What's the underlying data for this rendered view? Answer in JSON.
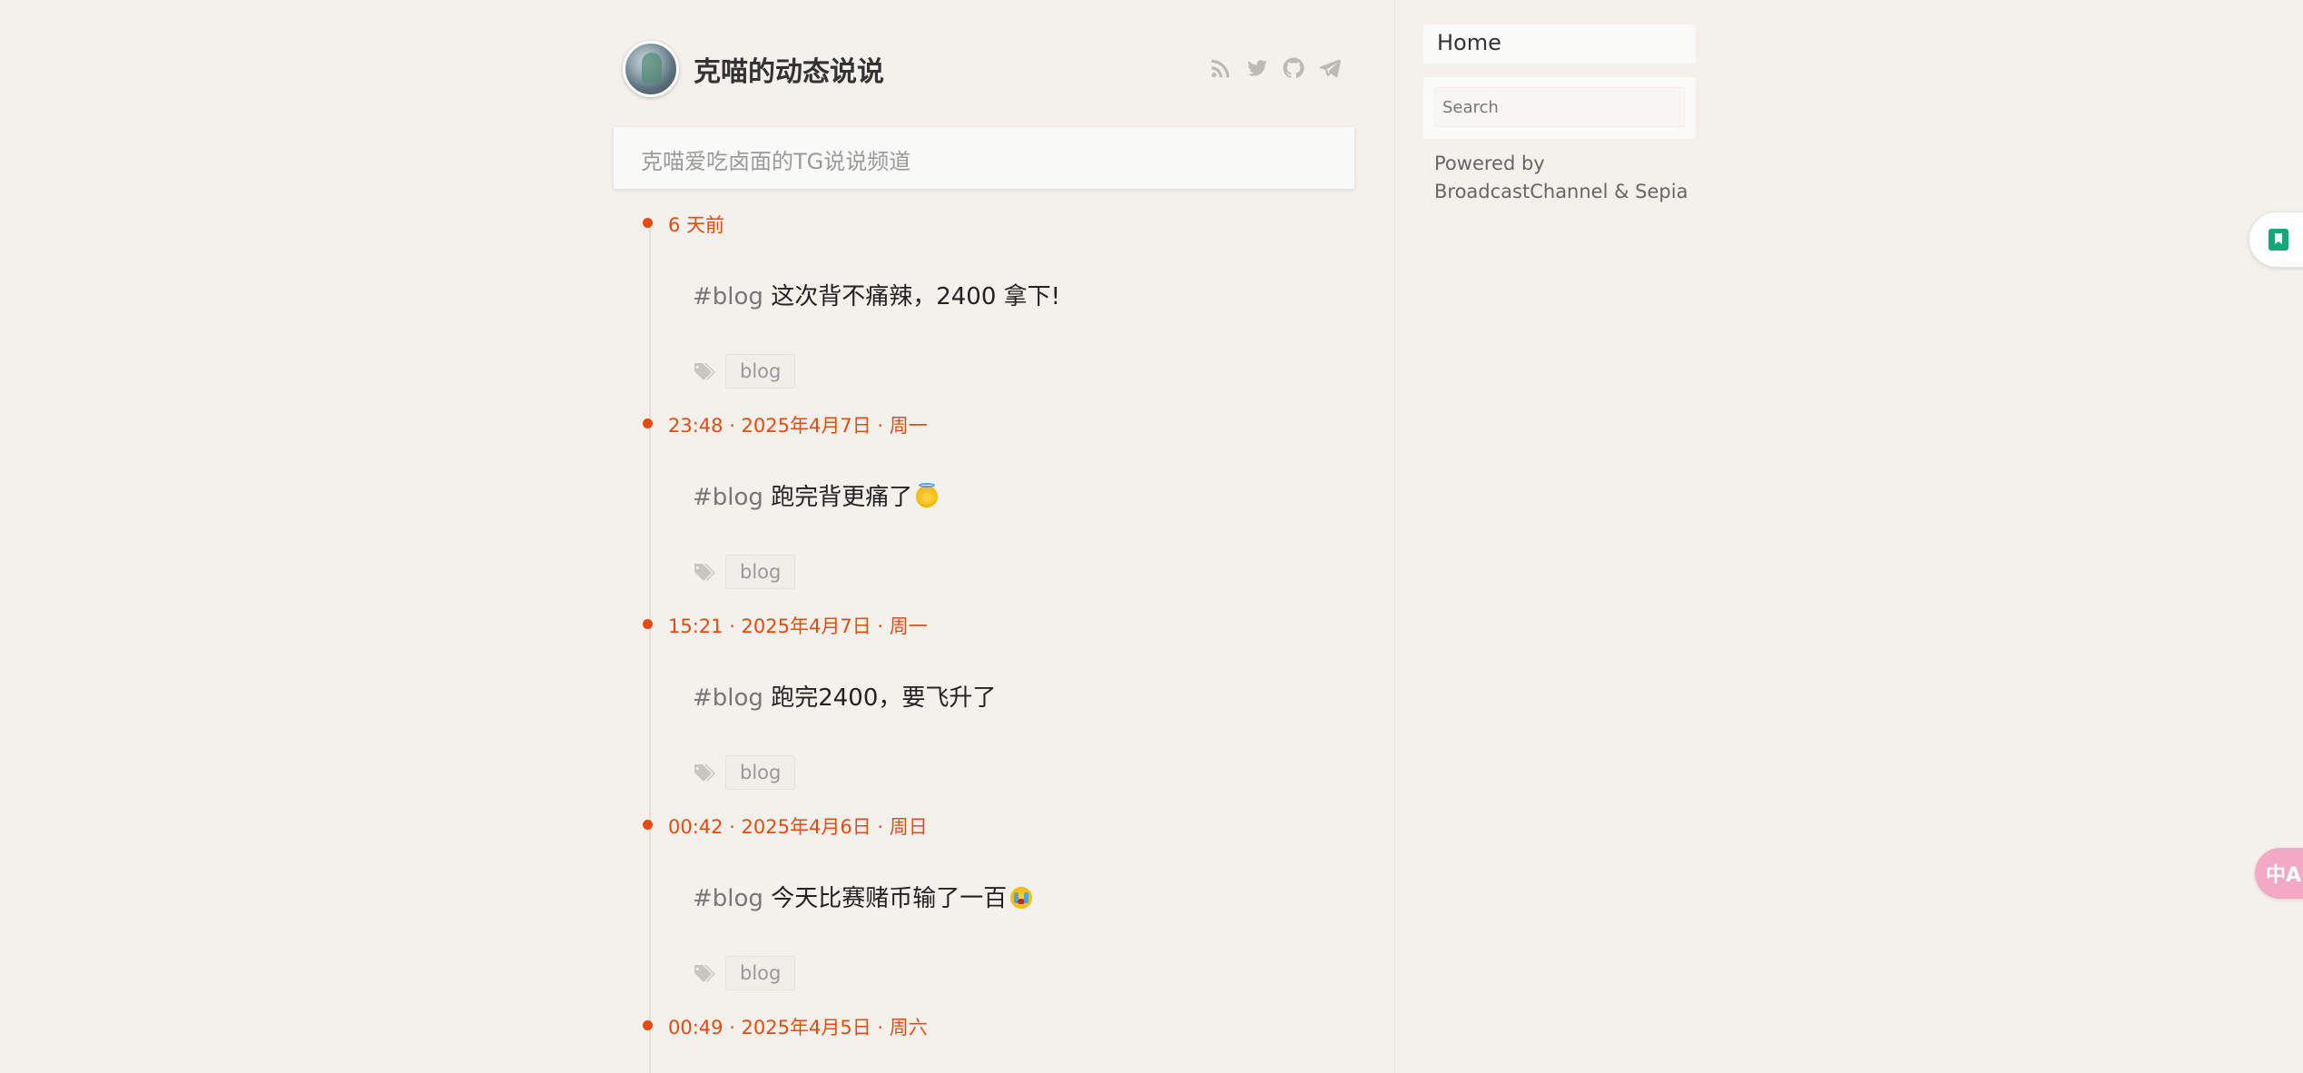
{
  "header": {
    "title": "克喵的动态说说",
    "social_icons": [
      "rss-icon",
      "twitter-icon",
      "github-icon",
      "telegram-icon"
    ]
  },
  "description": "克喵爱吃卤面的TG说说频道",
  "posts": [
    {
      "time": "6 天前",
      "hashtag": "#blog",
      "text": " 这次背不痛辣，2400 拿下!",
      "emoji": "",
      "tag": "blog"
    },
    {
      "time": "23:48 · 2025年4月7日 · 周一",
      "hashtag": "#blog",
      "text": " 跑完背更痛了",
      "emoji": "smiling-face-with-halo",
      "tag": "blog"
    },
    {
      "time": "15:21 · 2025年4月7日 · 周一",
      "hashtag": "#blog",
      "text": " 跑完2400，要飞升了",
      "emoji": "",
      "tag": "blog"
    },
    {
      "time": "00:42 · 2025年4月6日 · 周日",
      "hashtag": "#blog",
      "text": " 今天比赛赌币输了一百",
      "emoji": "crying-face",
      "tag": "blog"
    },
    {
      "time": "00:49 · 2025年4月5日 · 周六",
      "hashtag": "",
      "text": "",
      "emoji": "",
      "tag": ""
    }
  ],
  "sidebar": {
    "home_label": "Home",
    "search_placeholder": "Search",
    "powered_by": "Powered by BroadcastChannel & Sepia"
  },
  "floating": {
    "translate_label": "中A"
  },
  "colors": {
    "accent": "#e8490f",
    "background": "#f4f1ec",
    "card": "#fafaf9",
    "muted_icon": "#bdbab6"
  }
}
